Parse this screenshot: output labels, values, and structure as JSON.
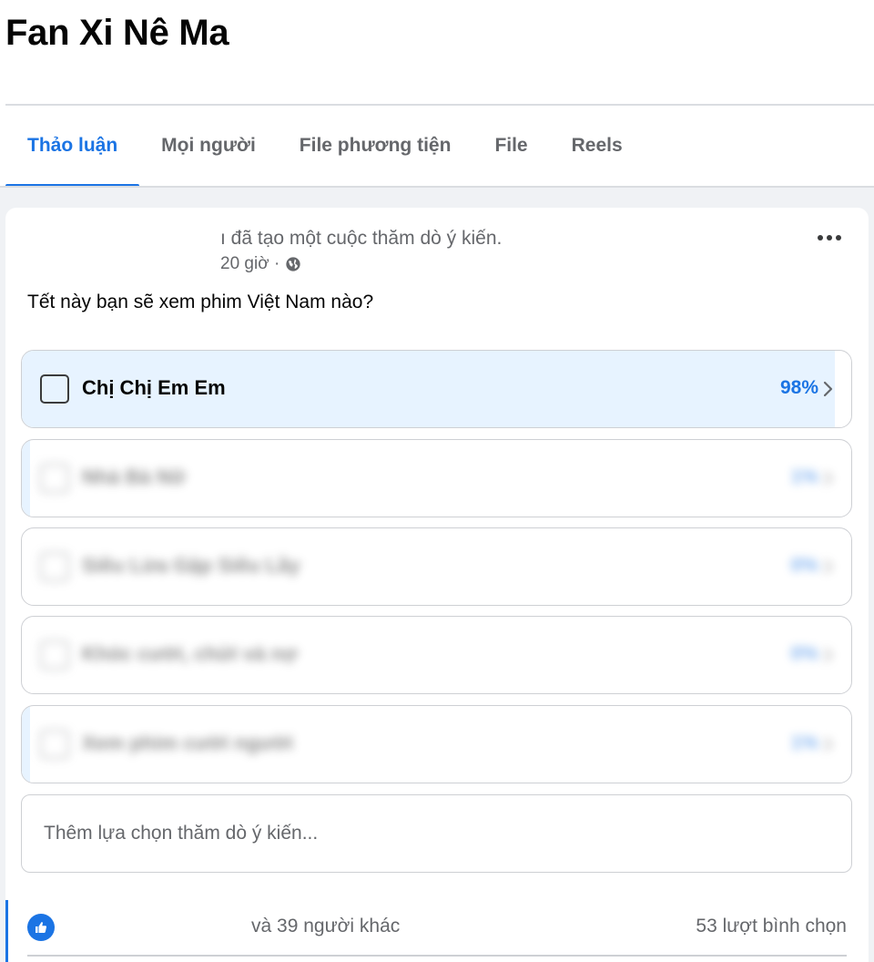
{
  "group": {
    "name": "Fan Xi Nê Ma"
  },
  "tabs": [
    {
      "label": "Thảo luận",
      "active": true
    },
    {
      "label": "Mọi người",
      "active": false
    },
    {
      "label": "File phương tiện",
      "active": false
    },
    {
      "label": "File",
      "active": false
    },
    {
      "label": "Reels",
      "active": false
    }
  ],
  "post": {
    "action_text": "ı đã tạo một cuộc thăm dò ý kiến.",
    "time": "20 giờ ·",
    "privacy_icon": "globe-icon",
    "more_icon": "more-dots-icon",
    "question": "Tết này bạn sẽ xem phim Việt Nam nào?"
  },
  "poll": {
    "options": [
      {
        "label": "Chị Chị Em Em",
        "percent_text": "98%",
        "fill_percent": 98,
        "blurred": false
      },
      {
        "label": "Nhà Bà Nữ",
        "percent_text": "1%",
        "fill_percent": 1,
        "blurred": true
      },
      {
        "label": "Siêu Lừa Gặp Siêu Lầy",
        "percent_text": "0%",
        "fill_percent": 0,
        "blurred": true
      },
      {
        "label": "Khóc cười, chửi và nợ",
        "percent_text": "0%",
        "fill_percent": 0,
        "blurred": true
      },
      {
        "label": "Xem phim cười người",
        "percent_text": "1%",
        "fill_percent": 1,
        "blurred": true
      }
    ],
    "add_placeholder": "Thêm lựa chọn thăm dò ý kiến...",
    "reactions_text": "và 39 người khác",
    "votes_text": "53 lượt bình chọn"
  },
  "colors": {
    "accent": "#1b74e4",
    "option_fill": "#e7f3ff",
    "secondary_text": "#65676b",
    "page_bg": "#f0f2f5"
  }
}
